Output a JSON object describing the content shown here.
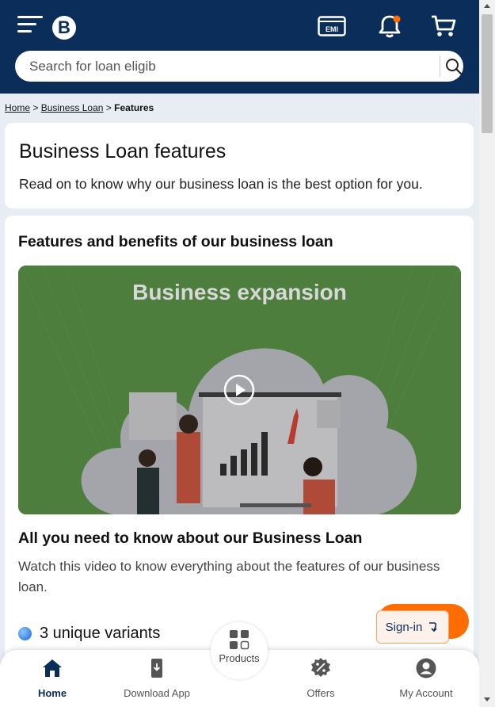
{
  "header": {
    "logo_letter": "B",
    "emi_label": "EMI"
  },
  "search": {
    "placeholder": "Search for loan eligib"
  },
  "breadcrumb": {
    "home": "Home",
    "sep1": ">",
    "business_loan": "Business Loan",
    "sep2": ">",
    "current": "Features"
  },
  "intro": {
    "title": "Business Loan features",
    "subtitle": "Read on to know why our business loan is the best option for you."
  },
  "features": {
    "heading": "Features and benefits of our business loan",
    "video_title": "Business expansion",
    "video_heading": "All you need to know about our Business Loan",
    "video_desc": "Watch this video to know everything about the features of our business loan.",
    "variants_label": "3 unique variants"
  },
  "signin": {
    "label": "Sign-in"
  },
  "bottom_nav": {
    "home": "Home",
    "download": "Download App",
    "products": "Products",
    "offers": "Offers",
    "account": "My Account"
  },
  "colors": {
    "brand_navy": "#0a2d5a",
    "accent_orange": "#ff6c00",
    "notification_dot": "#ff6c00"
  }
}
